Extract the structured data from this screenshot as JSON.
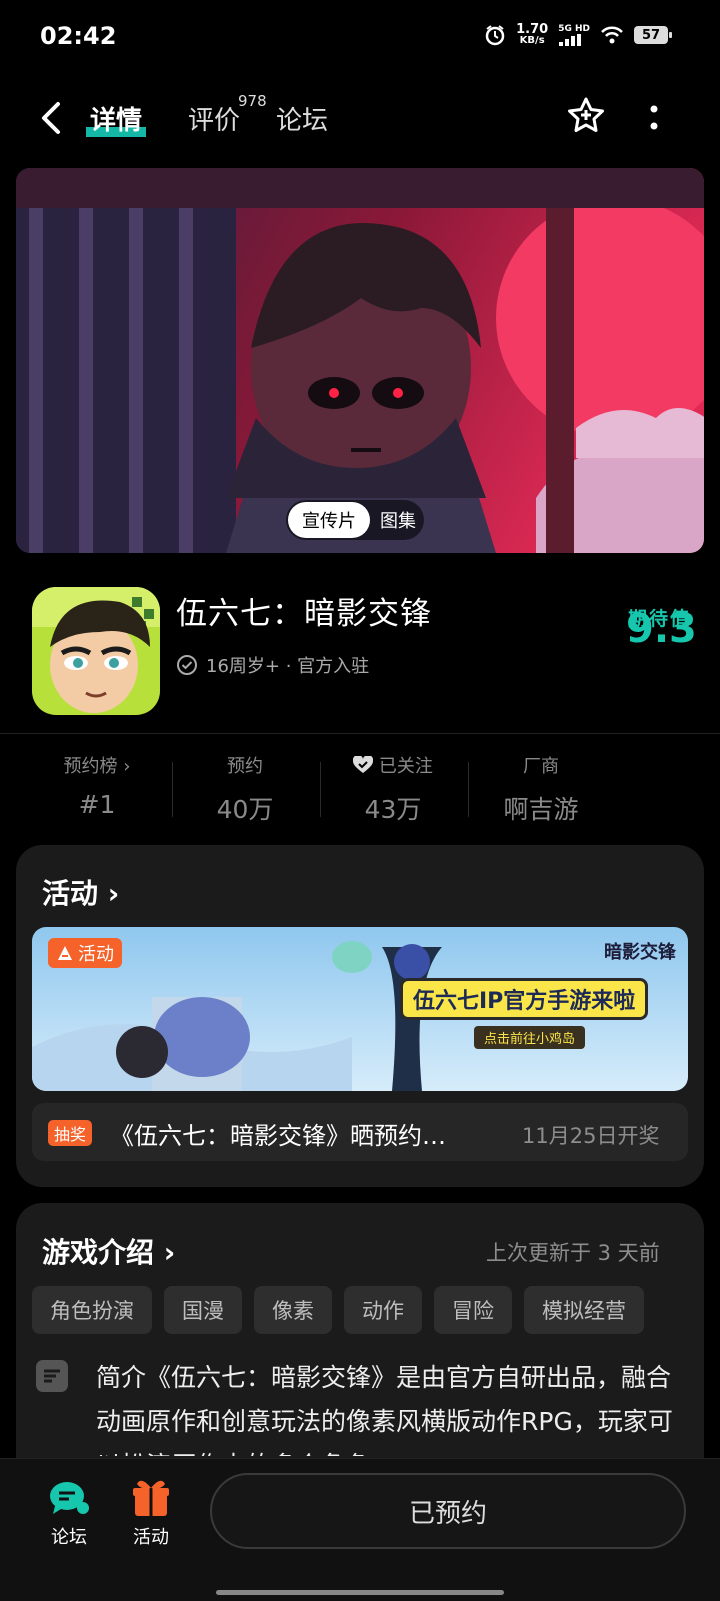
{
  "status_bar": {
    "time": "02:42",
    "net_speed": "1.70",
    "net_unit": "KB/s",
    "net_type": "5G HD",
    "battery": "57"
  },
  "header": {
    "tabs": [
      {
        "label": "详情",
        "active": true
      },
      {
        "label": "评价",
        "badge": "978"
      },
      {
        "label": "论坛"
      }
    ]
  },
  "banner": {
    "media_tabs": [
      "宣传片",
      "图集"
    ]
  },
  "app": {
    "title": "伍六七：暗影交锋",
    "meta": "16周岁+ · 官方入驻",
    "expect_label": "期待值",
    "expect_value": "9.3"
  },
  "stats": [
    {
      "label": "预约榜 ›",
      "value": "#1"
    },
    {
      "label": "预约",
      "value": "40万"
    },
    {
      "label": "已关注",
      "value": "43万"
    },
    {
      "label": "厂商",
      "value": "啊吉游"
    }
  ],
  "activity": {
    "title": "活动 ›",
    "promo_tag": "活动",
    "promo_headline": "伍六七IP官方手游来啦",
    "promo_sub": "点击前往小鸡岛",
    "promo_logo": "暗影交锋",
    "lottery_tag": "抽奖",
    "lottery_text": "《伍六七：暗影交锋》晒预约…",
    "lottery_date": "11月25日开奖"
  },
  "intro": {
    "title": "游戏介绍 ›",
    "updated": "上次更新于 3 天前",
    "tags": [
      "角色扮演",
      "国漫",
      "像素",
      "动作",
      "冒险",
      "模拟经营"
    ],
    "description": "简介《伍六七：暗影交锋》是由官方自研出品，融合动画原作和创意玩法的像素风横版动作RPG，玩家可以扮演原作中的多个角色"
  },
  "bottom": {
    "nav": [
      {
        "label": "论坛",
        "icon": "chat-bubble-icon"
      },
      {
        "label": "活动",
        "icon": "gift-icon"
      }
    ],
    "reserve": "已预约"
  },
  "colors": {
    "accent": "#16c6ad",
    "orange": "#f5622a",
    "background": "#000000",
    "card": "#1b1b1b"
  }
}
